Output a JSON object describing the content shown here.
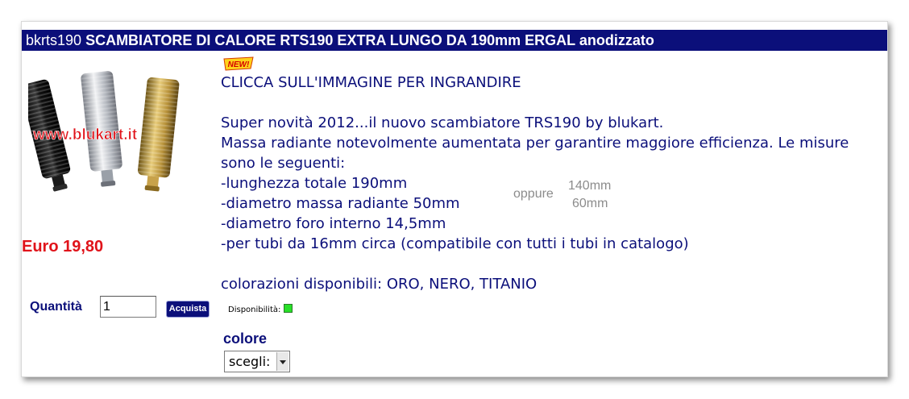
{
  "product": {
    "code": "bkrts190",
    "name": "SCAMBIATORE DI CALORE RTS190 EXTRA LUNGO DA 190mm ERGAL anodizzato",
    "image_watermark": "www.blukart.it",
    "price": "Euro 19,80",
    "badge": "NEW!"
  },
  "description": {
    "click_hint": "CLICCA SULL'IMMAGINE PER INGRANDIRE",
    "line1": "Super novità 2012...il nuovo scambiatore TRS190 by blukart.",
    "line2": "Massa radiante notevolmente aumentata per garantire maggiore efficienza. Le misure sono le seguenti:",
    "spec1": "-lunghezza totale 190mm",
    "spec2": "-diametro massa radiante 50mm",
    "spec3": "-diametro foro interno 14,5mm",
    "spec4": "-per tubi da 16mm circa (compatibile con tutti i tubi in catalogo)",
    "colors": "colorazioni disponibili: ORO, NERO, TITANIO",
    "alt_oppure": "oppure",
    "alt_length": "140mm",
    "alt_diameter": "60mm"
  },
  "purchase": {
    "quantity_label": "Quantità",
    "quantity_value": "1",
    "buy_label": "Acquista",
    "availability_label": "Disponibilità:",
    "availability_color": "#28e028"
  },
  "options": {
    "color_label": "colore",
    "color_selected": "scegli:"
  },
  "theme": {
    "primary": "#0b0f7a",
    "price_color": "#e0131a",
    "secondary_text": "#8c8c8c"
  }
}
